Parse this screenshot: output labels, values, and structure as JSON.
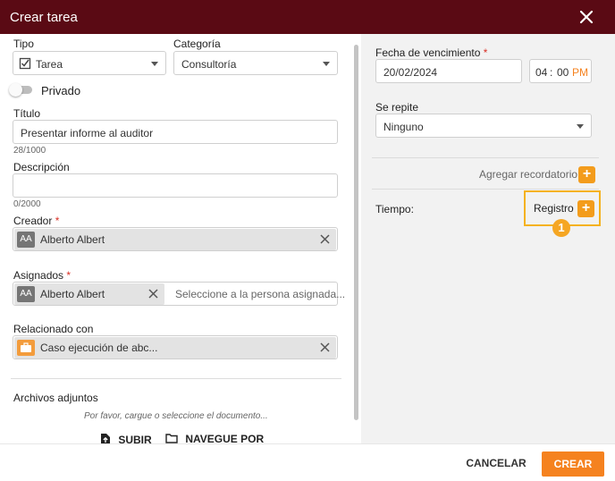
{
  "dialog": {
    "title": "Crear tarea"
  },
  "left": {
    "tipo": {
      "label": "Tipo",
      "value": "Tarea"
    },
    "categoria": {
      "label": "Categoría",
      "value": "Consultoría"
    },
    "privado": {
      "label": "Privado"
    },
    "titulo": {
      "label": "Título",
      "value": "Presentar informe al auditor",
      "counter": "28/1000"
    },
    "descripcion": {
      "label": "Descripción",
      "value": "",
      "counter": "0/2000"
    },
    "creador": {
      "label": "Creador",
      "required": "*",
      "chip_initials": "AA",
      "chip_name": "Alberto Albert"
    },
    "asignados": {
      "label": "Asignados",
      "required": "*",
      "chip_initials": "AA",
      "chip_name": "Alberto Albert",
      "placeholder": "Seleccione a la persona asignada..."
    },
    "relacionado": {
      "label": "Relacionado con",
      "chip_name": "Caso ejecución de abc..."
    },
    "archivos": {
      "label": "Archivos adjuntos",
      "hint": "Por favor, cargue o seleccione el documento...",
      "upload_label": "SUBIR",
      "browse_label": "NAVEGUE POR"
    }
  },
  "right": {
    "vencimiento": {
      "label": "Fecha de vencimiento",
      "required": "*",
      "date": "20/02/2024",
      "hour": "04",
      "sep": ":",
      "minute": "00",
      "ampm": "PM"
    },
    "repite": {
      "label": "Se repite",
      "value": "Ninguno"
    },
    "recordatorio": {
      "label": "Agregar recordatorio",
      "plus": "+"
    },
    "tiempo": {
      "label": "Tiempo:",
      "registro_label": "Registro",
      "plus": "+"
    },
    "step_badge": "1"
  },
  "footer": {
    "cancel_label": "CANCELAR",
    "create_label": "CREAR"
  },
  "colors": {
    "header": "#5a0a14",
    "accent": "#f5821f",
    "highlight": "#f5b21f"
  }
}
